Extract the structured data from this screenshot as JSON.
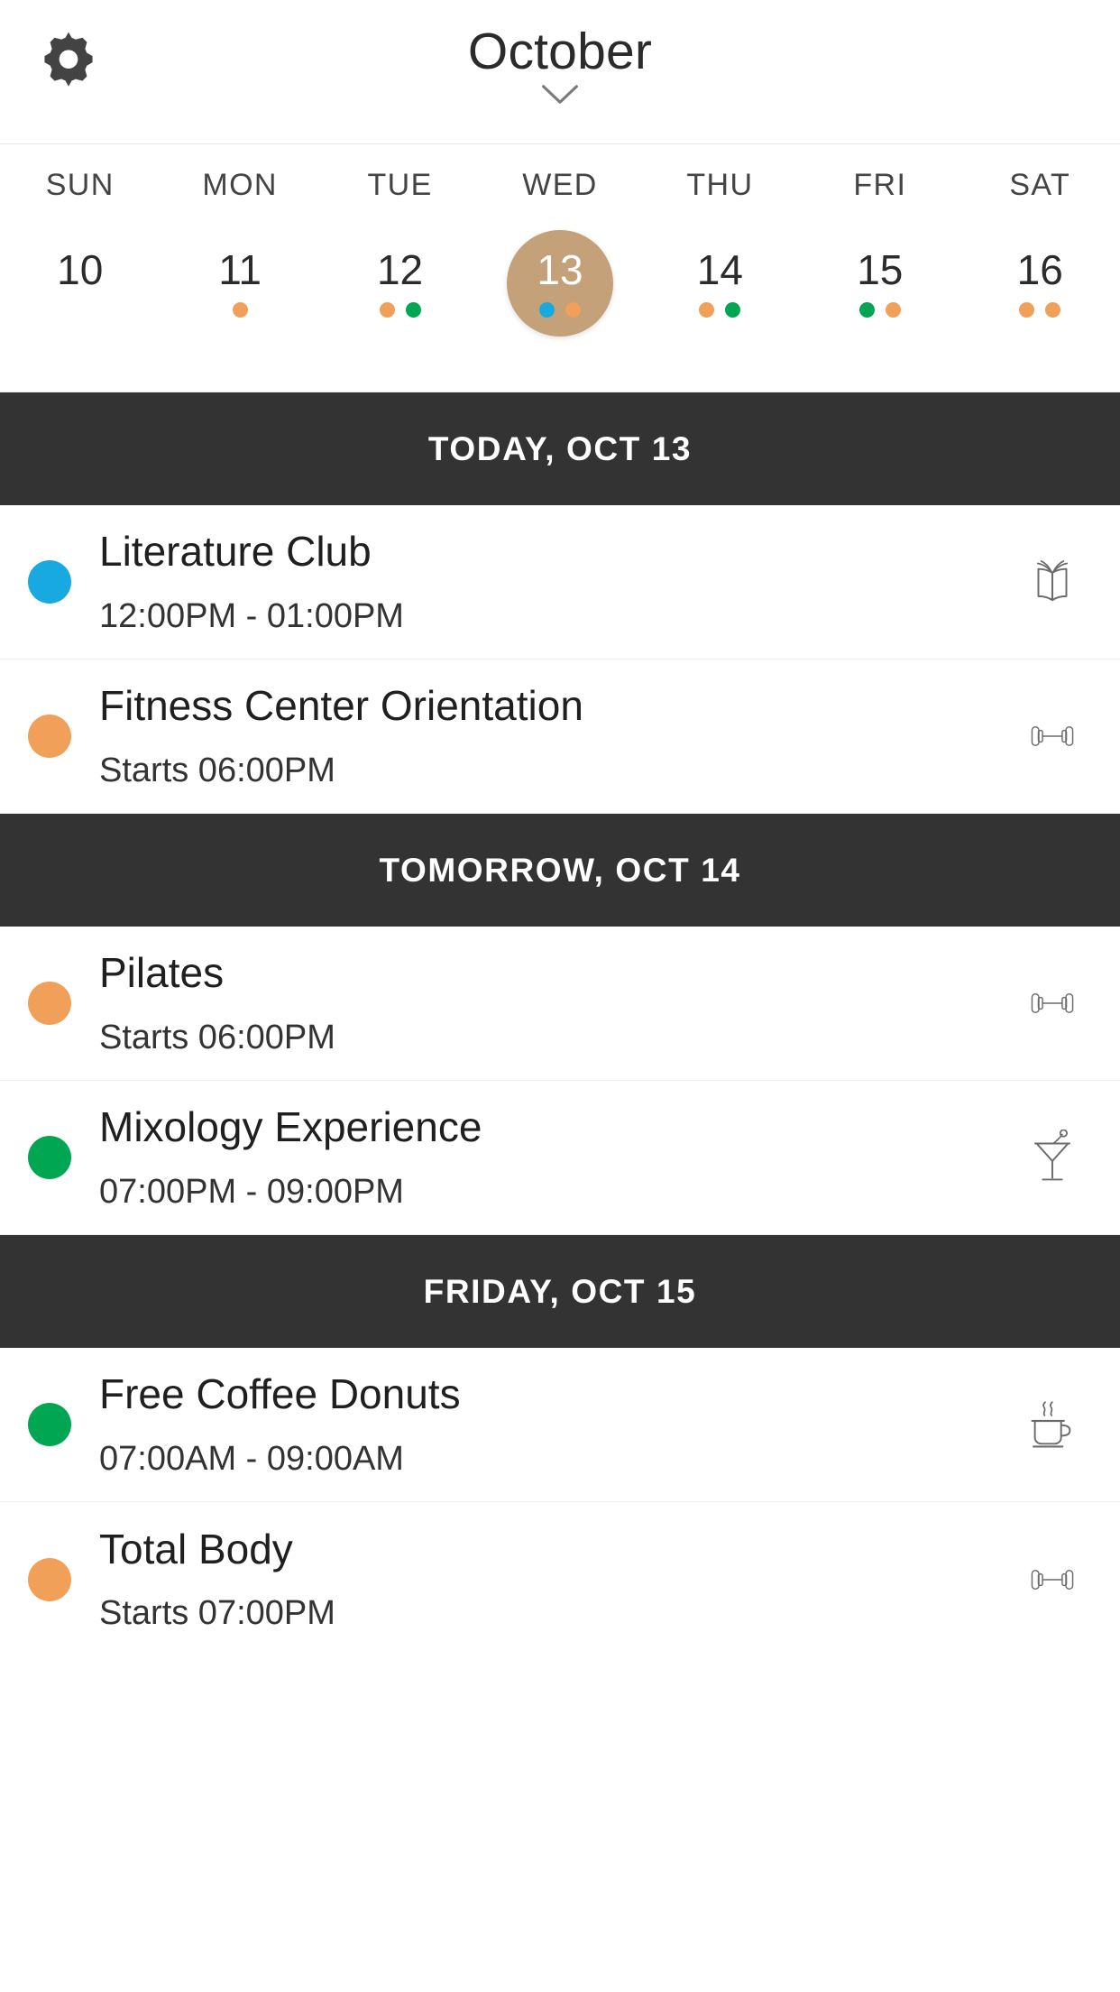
{
  "colors": {
    "accent_selected_day": "#c4a179",
    "header_bar": "#333333",
    "dot_orange": "#f0a059",
    "dot_green": "#00a651",
    "dot_blue": "#18a9e0",
    "page_background": "#ffffff",
    "text_primary": "#1f1f1f"
  },
  "header": {
    "settings_icon": "gear-icon",
    "month": "October",
    "month_caret_icon": "chevron-down-icon"
  },
  "week": {
    "day_labels": [
      "SUN",
      "MON",
      "TUE",
      "WED",
      "THU",
      "FRI",
      "SAT"
    ],
    "days": [
      {
        "number": "10",
        "selected": false,
        "dots": []
      },
      {
        "number": "11",
        "selected": false,
        "dots": [
          "#f0a059"
        ]
      },
      {
        "number": "12",
        "selected": false,
        "dots": [
          "#f0a059",
          "#00a651"
        ]
      },
      {
        "number": "13",
        "selected": true,
        "dots": [
          "#18a9e0",
          "#f0a059"
        ]
      },
      {
        "number": "14",
        "selected": false,
        "dots": [
          "#f0a059",
          "#00a651"
        ]
      },
      {
        "number": "15",
        "selected": false,
        "dots": [
          "#00a651",
          "#f0a059"
        ]
      },
      {
        "number": "16",
        "selected": false,
        "dots": [
          "#f0a059",
          "#f0a059"
        ]
      }
    ]
  },
  "sections": [
    {
      "header": "TODAY, OCT 13",
      "events": [
        {
          "title": "Literature Club",
          "time": "12:00PM - 01:00PM",
          "dot_color": "#18a9e0",
          "icon": "open-book-icon"
        },
        {
          "title": "Fitness Center Orientation",
          "time": "Starts 06:00PM",
          "dot_color": "#f0a059",
          "icon": "dumbbell-icon"
        }
      ]
    },
    {
      "header": "TOMORROW, OCT 14",
      "events": [
        {
          "title": "Pilates",
          "time": "Starts 06:00PM",
          "dot_color": "#f0a059",
          "icon": "dumbbell-icon"
        },
        {
          "title": "Mixology Experience",
          "time": "07:00PM - 09:00PM",
          "dot_color": "#00a651",
          "icon": "cocktail-icon"
        }
      ]
    },
    {
      "header": "FRIDAY, OCT 15",
      "events": [
        {
          "title": "Free Coffee Donuts",
          "time": "07:00AM - 09:00AM",
          "dot_color": "#00a651",
          "icon": "coffee-cup-icon"
        },
        {
          "title": "Total Body",
          "time": "Starts 07:00PM",
          "dot_color": "#f0a059",
          "icon": "dumbbell-icon"
        }
      ]
    }
  ]
}
